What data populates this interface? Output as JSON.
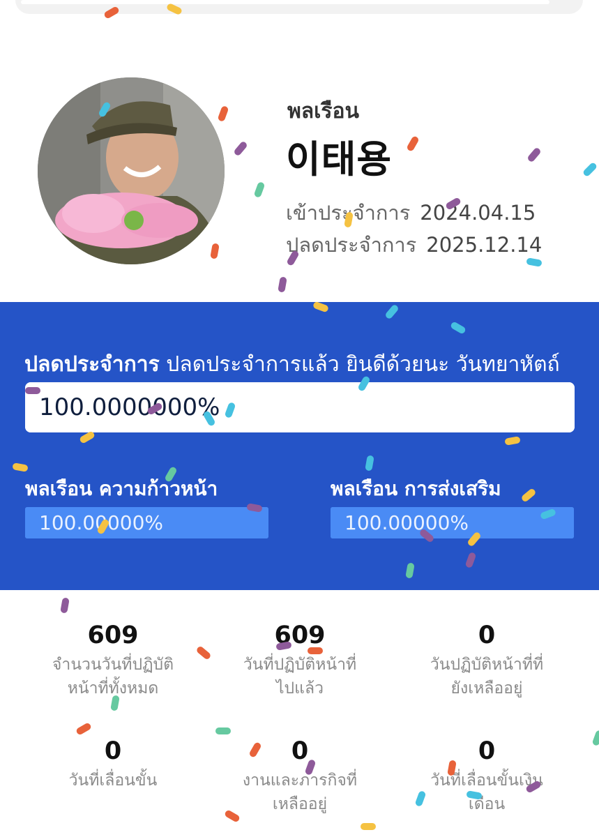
{
  "profile": {
    "rank": "พลเรือน",
    "name": "이태용",
    "enlist_label": "เข้าประจำการ",
    "enlist_date": "2024.04.15",
    "discharge_label": "ปลดประจำการ",
    "discharge_date": "2025.12.14"
  },
  "discharge": {
    "title": "ปลดประจำการ",
    "message": "ปลดประจำการแล้ว ยินดีด้วยนะ วันทยาหัตถ์",
    "progress_text": "100.0000000%",
    "progress_value": 100
  },
  "progress_cards": [
    {
      "label": "พลเรือน ความก้าวหน้า",
      "value_text": "100.00000%",
      "value": 100
    },
    {
      "label": "พลเรือน การส่งเสริม",
      "value_text": "100.00000%",
      "value": 100
    }
  ],
  "stats": [
    {
      "value": "609",
      "caption_line1": "จำนวนวันที่ปฏิบัติ",
      "caption_line2": "หน้าที่ทั้งหมด"
    },
    {
      "value": "609",
      "caption_line1": "วันที่ปฏิบัติหน้าที่",
      "caption_line2": "ไปแล้ว"
    },
    {
      "value": "0",
      "caption_line1": "วันปฏิบัติหน้าที่ที่",
      "caption_line2": "ยังเหลืออยู่"
    },
    {
      "value": "0",
      "caption_line1": "วันที่เลื่อนขั้น",
      "caption_line2": ""
    },
    {
      "value": "0",
      "caption_line1": "งานและภารกิจที่",
      "caption_line2": "เหลืออยู่"
    },
    {
      "value": "0",
      "caption_line1": "วันที่เลื่อนขั้นเงิน",
      "caption_line2": "เดือน"
    }
  ],
  "colors": {
    "banner": "#2554c7",
    "sub_bar": "#4a8bf5",
    "confetti": [
      "#e8623a",
      "#f5c242",
      "#46c1e0",
      "#8e5a9a",
      "#66c9a0"
    ]
  }
}
